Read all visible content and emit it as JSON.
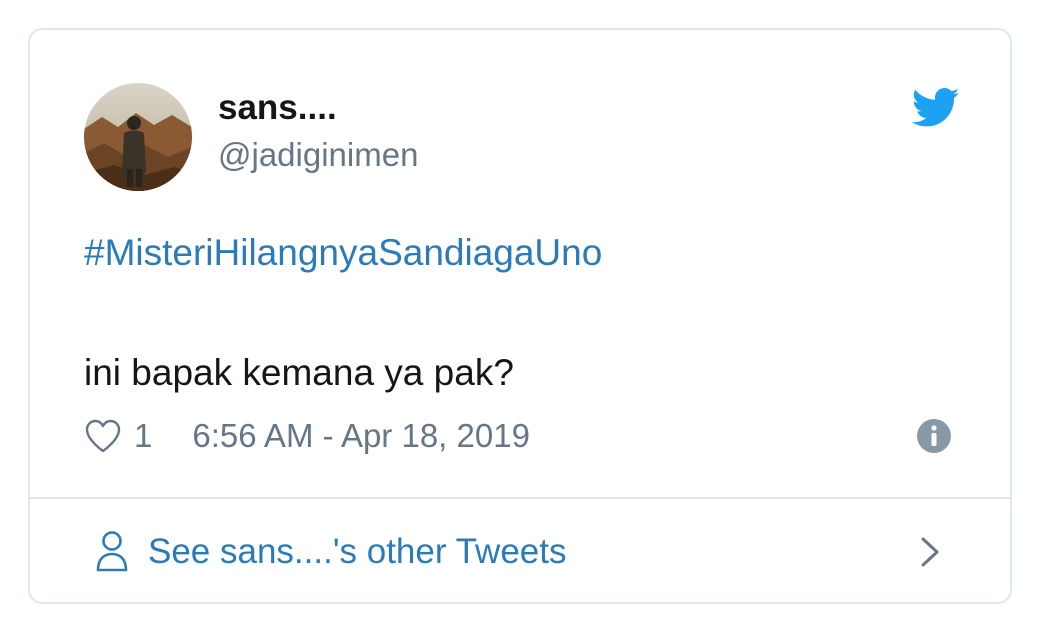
{
  "tweet": {
    "author": {
      "display_name": "sans....",
      "handle": "@jadiginimen"
    },
    "hashtag": "#MisteriHilangnyaSandiagaUno",
    "text": "ini bapak kemana ya pak?",
    "like_count": "1",
    "timestamp": "6:56 AM - Apr 18, 2019"
  },
  "footer": {
    "label": "See sans....'s other Tweets"
  },
  "icons": {
    "brand": "twitter-bird-icon",
    "like": "heart-icon",
    "info": "info-icon",
    "profile": "person-icon",
    "more": "chevron-right-icon"
  },
  "colors": {
    "link": "#2b7bb9",
    "brand": "#1da1f2",
    "text": "#14171a",
    "muted": "#657786",
    "border": "#e1e8ed"
  }
}
